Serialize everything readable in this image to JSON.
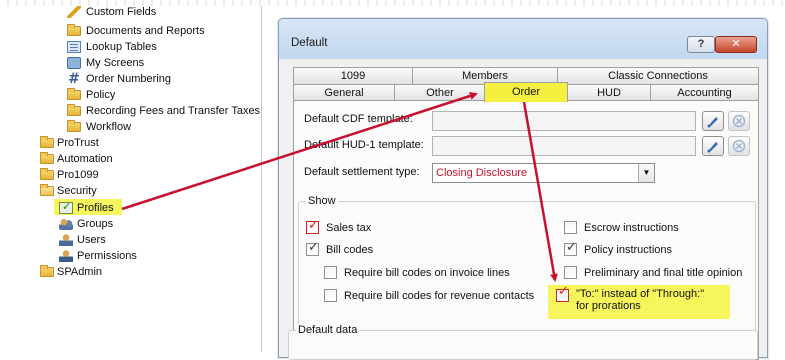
{
  "tree": {
    "items": [
      {
        "label": "Custom Fields",
        "icon": "pencil-icon"
      },
      {
        "label": "Documents and Reports",
        "icon": "folder-icon"
      },
      {
        "label": "Lookup Tables",
        "icon": "lookup-table-icon"
      },
      {
        "label": "My Screens",
        "icon": "screens-icon"
      },
      {
        "label": "Order Numbering",
        "icon": "hash-icon"
      },
      {
        "label": "Policy",
        "icon": "folder-icon"
      },
      {
        "label": "Recording Fees and Transfer Taxes",
        "icon": "folder-icon"
      },
      {
        "label": "Workflow",
        "icon": "folder-icon"
      },
      {
        "label": "ProTrust",
        "icon": "folder-icon"
      },
      {
        "label": "Automation",
        "icon": "folder-icon"
      },
      {
        "label": "Pro1099",
        "icon": "folder-icon"
      },
      {
        "label": "Security",
        "icon": "folder-open-icon"
      },
      {
        "label": "Profiles",
        "icon": "profiles-icon"
      },
      {
        "label": "Groups",
        "icon": "groups-icon"
      },
      {
        "label": "Users",
        "icon": "user-icon"
      },
      {
        "label": "Permissions",
        "icon": "permissions-icon"
      },
      {
        "label": "SPAdmin",
        "icon": "folder-icon"
      }
    ],
    "highlight_color": "#f7f55c"
  },
  "dialog": {
    "title": "Default",
    "help_label": "?",
    "close_label": "✕",
    "tabs_row1": [
      "1099",
      "Members",
      "Classic Connections"
    ],
    "tabs_row2": [
      "General",
      "Other",
      "Order",
      "HUD",
      "Accounting"
    ],
    "active_tab": "Order",
    "fields": {
      "cdf_label": "Default CDF template:",
      "hud_label": "Default HUD-1 template:",
      "settlement_label": "Default settlement type:",
      "settlement_value": "Closing Disclosure"
    },
    "show": {
      "legend": "Show",
      "sales_tax": "Sales tax",
      "bill_codes": "Bill codes",
      "require_invoice": "Require bill codes on invoice lines",
      "require_revenue": "Require bill codes for revenue contacts",
      "escrow": "Escrow instructions",
      "policy": "Policy instructions",
      "preliminary": "Preliminary and final title opinion",
      "to_instead_line1": "\"To:\" instead of \"Through:\"",
      "to_instead_line2": "for prorations"
    },
    "default_data_legend": "Default data"
  },
  "colors": {
    "annotation_arrow": "#c8102e",
    "highlight": "#f7f55c",
    "settlement_text": "#c8102e"
  }
}
